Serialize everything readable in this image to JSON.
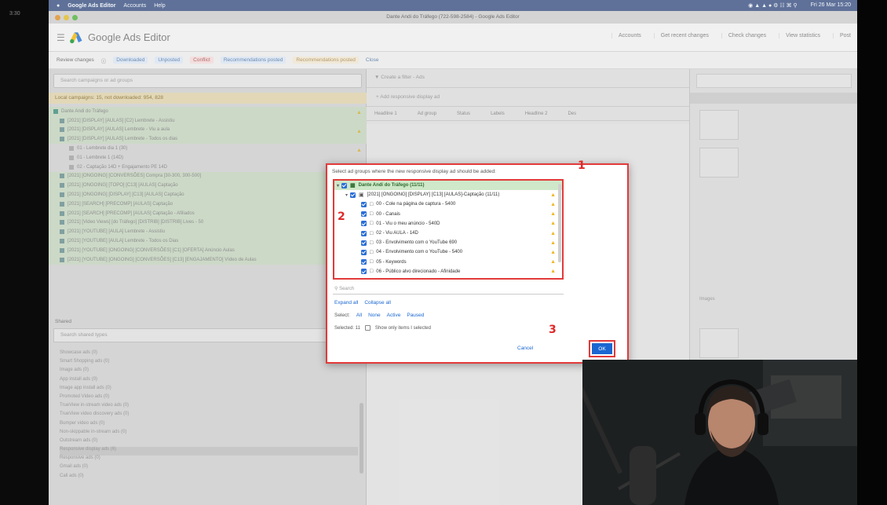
{
  "left_bar": {
    "time": "3:30"
  },
  "menubar": {
    "app": "Google Ads Editor",
    "items": [
      "Accounts",
      "Help"
    ],
    "right_text": "Fri 26 Mar 15:20"
  },
  "window_title": "Dante Andi do Tráfego (722-598-2584) - Google Ads Editor",
  "app_header": {
    "brand": "Google Ads Editor",
    "buttons": [
      "Accounts",
      "Get recent changes",
      "Check changes",
      "View statistics",
      "Post"
    ]
  },
  "subbar": {
    "label": "Review changes",
    "chips": [
      "Downloaded",
      "Unposted",
      "Conflict",
      "Recommendations posted",
      "Recommendations posted",
      "Close"
    ]
  },
  "left_panel": {
    "search_placeholder": "Search campaigns or ad groups",
    "notice": "Local campaigns: 15, not downloaded: 954, 828",
    "tree": [
      "Dante Andi do Tráfego",
      "[2021] [DISPLAY] [AULAS] [C2] Lembrete - Assistiu",
      "[2021] [DISPLAY] [AULAS] Lembrete - Viu a aula",
      "[2021] [DISPLAY] [AULAS] Lembrete - Todos os dias",
      "01 - Lembrete dia 1 (30)",
      "01 - Lembrete 1 (14D)",
      "02 - Captação 14D + Engajamento PE 14D",
      "[2021] [ONGOING] [CONVERSÕES] Compra [30-300, 300-500]",
      "[2021] [ONGOING] [TOPO] [C13] [AULAS] Captação",
      "[2021] [ONGOING] [DISPLAY] [C13] [AULAS] Captação",
      "[2021] [SEARCH] [PRECOMP] [AULAS] Captação",
      "[2021] [SEARCH] [PRECOMP] [AULAS] Captação - Afiliados",
      "[2021] [Video Views] [do Tráfego] [DISTRIB] [DISTRIB] Lives - 50",
      "[2021] [YOUTUBE] [AULA] Lembrete - Assistiu",
      "[2021] [YOUTUBE] [AULA] Lembrete - Todos os Dias",
      "[2021] [YOUTUBE] [ONGOING] [CONVERSÕES] [C1] [OFERTA] Anúncio Aulas",
      "[2021] [YOUTUBE] [ONGOING] [CONVERSÕES] [C13] [ENGAJAMENTO] Vídeo de Aulas"
    ],
    "shared_heading": "Shared",
    "shared_search": "Search shared types",
    "shared_items": [
      "Showcase ads (0)",
      "Smart Shopping ads (0)",
      "Image ads (0)",
      "App install ads (0)",
      "Image app install ads (0)",
      "Promoted Video ads (0)",
      "TrueView in-stream video ads (0)",
      "TrueView video discovery ads (0)",
      "Bumper video ads (0)",
      "Non-skippable in-stream ads (0)",
      "Outstream ads (0)",
      "Responsive display ads (6)",
      "Responsive ads (0)",
      "Gmail ads (0)",
      "Call ads (0)"
    ],
    "selected_index": 11
  },
  "mid_panel": {
    "filter_placeholder": "Create a filter - Ads",
    "add_button": "+ Add responsive display ad",
    "columns": [
      "Headline 1",
      "Ad group",
      "Status",
      "Labels",
      "Headline 2",
      "Des"
    ]
  },
  "right_panel": {
    "label": "Images"
  },
  "dialog": {
    "title": "Select ad groups where the new responsive display ad should be added:",
    "rows": [
      {
        "text": "Dante Andi do Tráfego (11/11)",
        "level": 0,
        "type": "top"
      },
      {
        "text": "[2021] [ONGOING] [DISPLAY] [C13] [AULAS]-Captação (11/11)",
        "level": 1,
        "type": "campaign"
      },
      {
        "text": "00 - Cole na página de captura - 5400",
        "level": 2,
        "type": "adgroup"
      },
      {
        "text": "00 - Canais",
        "level": 2,
        "type": "adgroup"
      },
      {
        "text": "01 - Viu o meu anúncio - 540D",
        "level": 2,
        "type": "adgroup"
      },
      {
        "text": "02 - Viu AULA - 14D",
        "level": 2,
        "type": "adgroup"
      },
      {
        "text": "03 - Envolvimento com o YouTube 690",
        "level": 2,
        "type": "adgroup"
      },
      {
        "text": "04 - Envolvimento com o YouTube - 5400",
        "level": 2,
        "type": "adgroup"
      },
      {
        "text": "05 - Keywords",
        "level": 2,
        "type": "adgroup"
      },
      {
        "text": "06 - Público alvo direcionado - Afinidade",
        "level": 2,
        "type": "adgroup"
      }
    ],
    "search_placeholder": "Search",
    "expand_all": "Expand all",
    "collapse_all": "Collapse all",
    "select_label": "Select:",
    "select_options": [
      "All",
      "None",
      "Active",
      "Paused"
    ],
    "selected_label": "Selected: 11",
    "show_only_label": "Show only items I selected",
    "cancel": "Cancel",
    "ok": "OK"
  },
  "annotations": [
    "1",
    "2",
    "3"
  ],
  "colors": {
    "annotation": "#e23a3a",
    "accent": "#1a67d2",
    "warning": "#f1b522"
  }
}
